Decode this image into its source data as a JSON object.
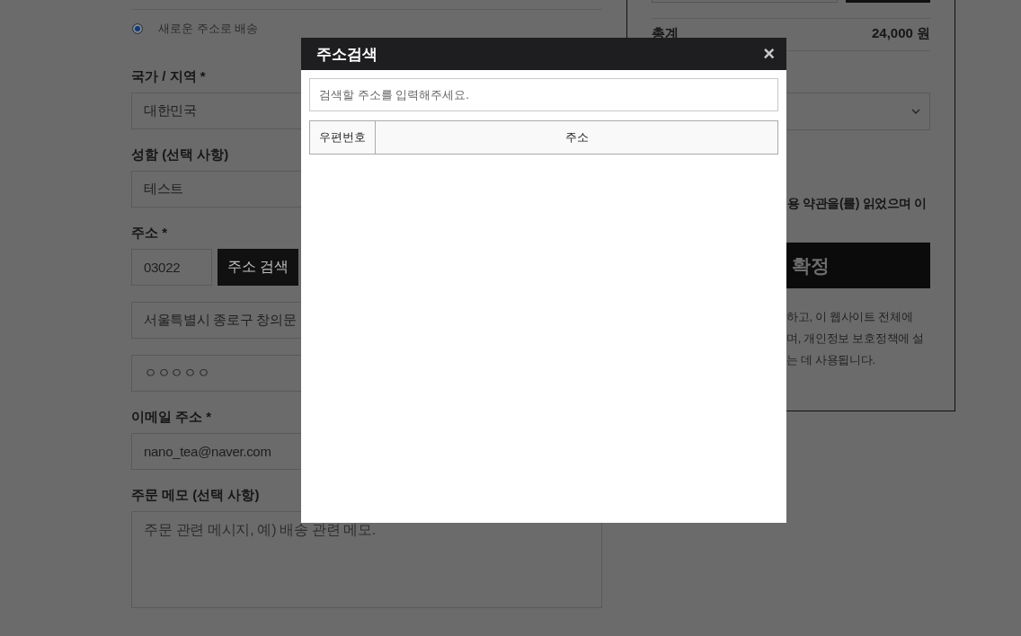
{
  "checkout_form": {
    "ship_option": {
      "label": "새로운 주소로 배송",
      "selected": true
    },
    "fields": [
      {
        "kind": "text",
        "label": "국가 / 지역 *",
        "value": "대한민국"
      },
      {
        "kind": "text",
        "label": "성함 (선택 사항)",
        "value": "테스트"
      },
      {
        "kind": "zip",
        "label": "주소 *",
        "value": "03022",
        "button": "주소 검색"
      },
      {
        "kind": "text",
        "value": "서울특별시 종로구 창의문"
      },
      {
        "kind": "text",
        "value": "ㅇㅇㅇㅇㅇ"
      },
      {
        "kind": "text",
        "label": "이메일 주소 *",
        "value": "nano_tea@naver.com"
      },
      {
        "kind": "textarea",
        "label": "주문 메모 (선택 사항)",
        "placeholder": "주문 관련 메시지, 예) 배송 관련 메모."
      }
    ]
  },
  "order_summary": {
    "total_label": "총계",
    "total_value": "24,000 원",
    "terms_text": "용 약관을(를) 읽었으며 이",
    "order_button": "확정",
    "privacy_lines": [
      "하고, 이 웹사이트 전체에",
      "며, 개인정보 보호정책에 설",
      "는 데 사용됩니다."
    ]
  },
  "address_modal": {
    "title": "주소검색",
    "close": "×",
    "search": {
      "placeholder": "검색할 주소를 입력해주세요."
    },
    "table": {
      "columns": [
        "우편번호",
        "주소"
      ]
    }
  }
}
